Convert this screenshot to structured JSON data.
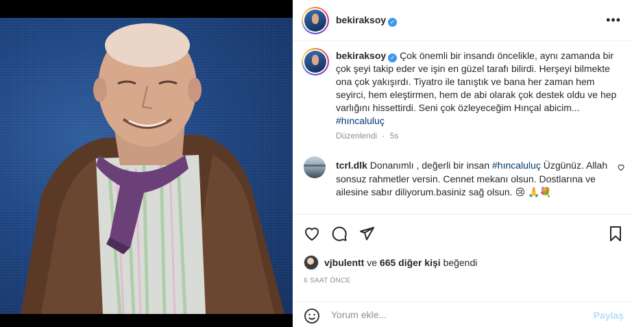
{
  "post": {
    "username": "bekiraksoy",
    "verified_mark": "✓"
  },
  "header": {
    "more_icon": "•••"
  },
  "caption": {
    "username": "bekiraksoy",
    "text": "Çok önemli bir insandı öncelikle, aynı zamanda bir çok şeyi takip eder ve işin en güzel tarafı bilirdi. Herşeyi bilmekte ona çok yakışırdı. Tiyatro ile tanıştık ve bana her zaman hem seyirci, hem eleştirmen, hem de abi olarak çok destek oldu ve hep varlığını hissettirdi. Seni çok özleyeceğim Hınçal abicim... ",
    "hashtag": "#hıncaluluç",
    "edited_label": "Düzenlendi",
    "age": "5s"
  },
  "comment": {
    "username": "tcrl.dlk",
    "text_before": "Donanımlı , değerli bir insan ",
    "hashtag": "#hıncaluluç",
    "text_after": " Üzgünüz. Allah sonsuz rahmetler versin. Cennet mekanı olsun. Dostlarına ve ailesine sabır diliyorum.basiniz sağ olsun. 😢 🙏💐"
  },
  "likes": {
    "user": "vjbulentt",
    "connector": " ve ",
    "others": "665 diğer kişi",
    "suffix": " beğendi"
  },
  "timestamp": "6 SAAT ÖNCE",
  "comment_box": {
    "placeholder": "Yorum ekle...",
    "post_label": "Paylaş"
  },
  "icons": {
    "heart": "heart-icon",
    "comment": "comment-icon",
    "share": "share-icon",
    "save": "bookmark-icon",
    "emoji": "emoji-icon"
  },
  "colors": {
    "hashtag": "#00376b",
    "verified": "#3897f0",
    "post_button_disabled": "#b2dffc",
    "muted": "#8e8e8e"
  }
}
